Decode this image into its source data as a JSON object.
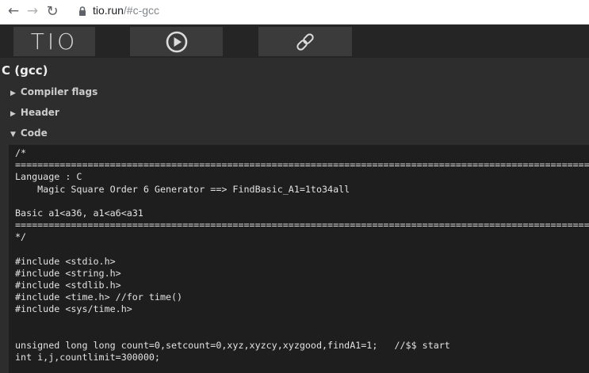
{
  "browser": {
    "back_icon": "arrow-left-icon",
    "forward_icon": "arrow-right-icon",
    "reload_icon": "reload-icon",
    "lock_icon": "lock-icon",
    "url_host": "tio.run",
    "url_path": "/#c-gcc"
  },
  "toolbar": {
    "logo_text": "TIO",
    "run_icon": "play-circle-icon",
    "permalink_icon": "chain-link-icon"
  },
  "language": {
    "title": "C (gcc)"
  },
  "sections": {
    "compiler_flags": {
      "arrow": "▶",
      "label": "Compiler flags"
    },
    "header": {
      "arrow": "▶",
      "label": "Header"
    },
    "code": {
      "arrow": "▼",
      "label": "Code"
    }
  },
  "code_lines": [
    "/*",
    "=========================================================================================================================",
    "Language : C",
    "    Magic Square Order 6 Generator ==> FindBasic_A1=1to34all",
    "",
    "Basic a1<a36, a1<a6<a31",
    "=========================================================================================================================",
    "*/",
    "",
    "#include <stdio.h>",
    "#include <string.h>",
    "#include <stdlib.h>",
    "#include <time.h> //for time()",
    "#include <sys/time.h>",
    "",
    "",
    "unsigned long long count=0,setcount=0,xyz,xyzcy,xyzgood,findA1=1;   //$$ start",
    "int i,j,countlimit=300000;"
  ]
}
